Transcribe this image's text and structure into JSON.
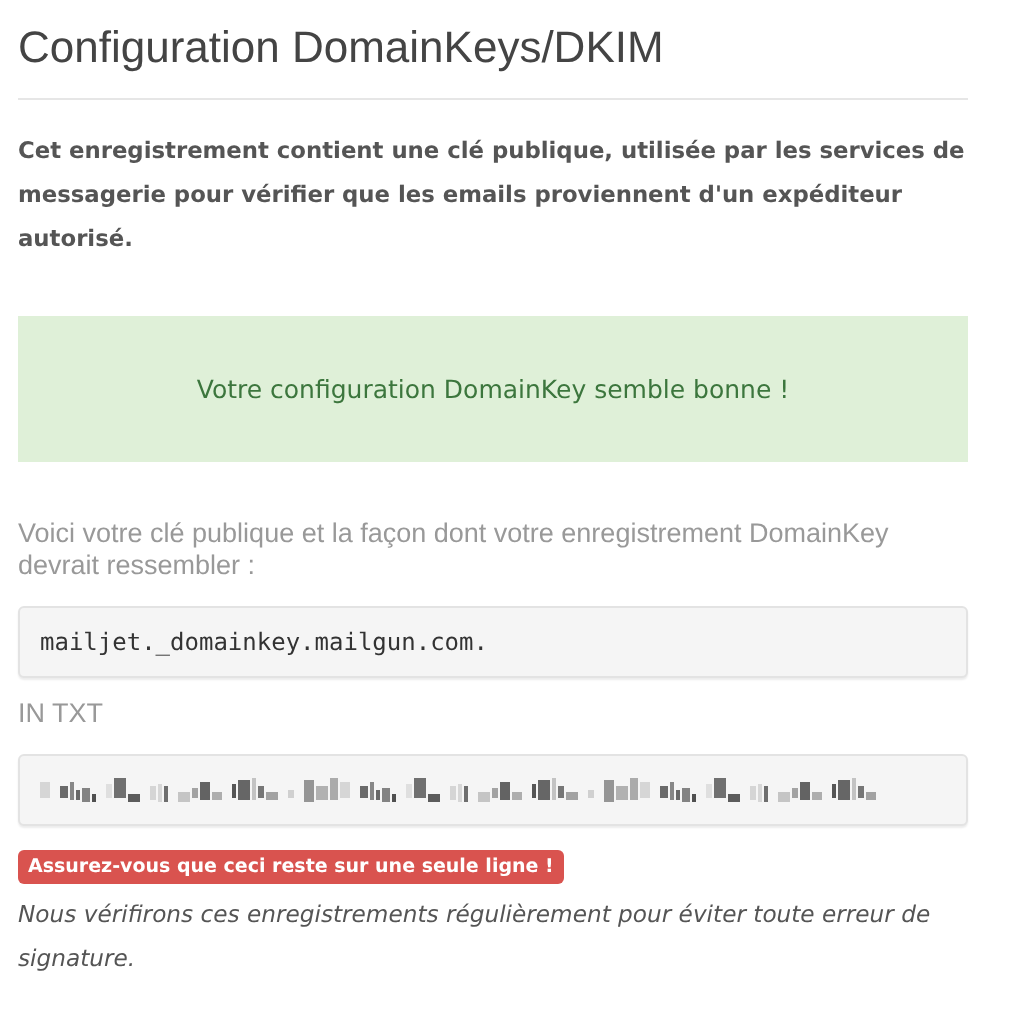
{
  "title": "Configuration DomainKeys/DKIM",
  "intro": "Cet enregistrement contient une clé publique, utilisée par les services de messagerie pour vérifier que les emails proviennent d'un expéditeur autorisé.",
  "alert": {
    "kind": "success",
    "text": "Votre configuration DomainKey semble bonne !"
  },
  "record_label": "Voici votre clé publique et la façon dont votre enregistrement DomainKey devrait ressembler :",
  "record_name": "mailjet._domainkey.mailgun.com.",
  "record_type": "IN TXT",
  "warning": {
    "kind": "danger",
    "text": "Assurez-vous que ceci reste sur une seule ligne !"
  },
  "note": "Nous vérifirons ces enregistrements régulièrement pour éviter toute erreur de signature."
}
